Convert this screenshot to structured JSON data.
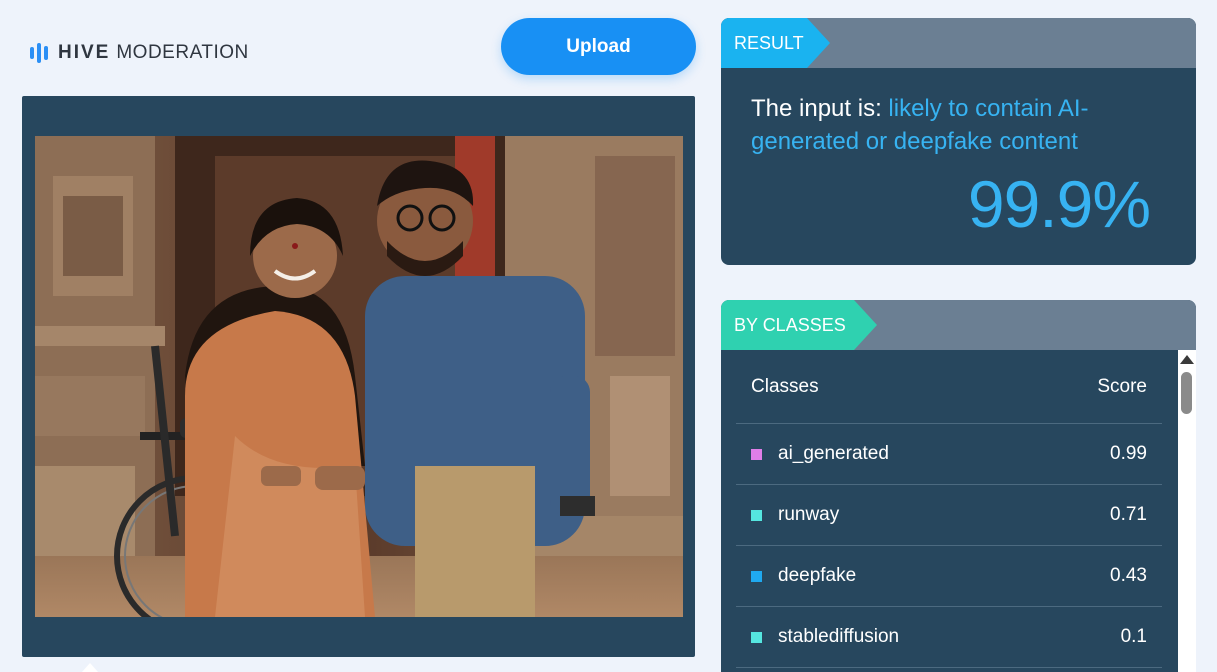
{
  "header": {
    "brand": "HIVE",
    "brand_sub": "MODERATION",
    "upload_label": "Upload"
  },
  "image_panel": {
    "icon": "uploaded-photo",
    "subject": "photo of a smiling woman in a wheelchair and a man in glasses in front of a carved stone temple"
  },
  "result": {
    "tag": "RESULT",
    "prefix": "The input is: ",
    "verdict": "likely to contain AI-generated or deepfake content",
    "percent": "99.9%",
    "accent_color": "#37b3f2"
  },
  "by_classes": {
    "tag": "BY CLASSES",
    "header_class": "Classes",
    "header_score": "Score",
    "rows": [
      {
        "label": "ai_generated",
        "score": "0.99",
        "color": "#e07ee8"
      },
      {
        "label": "runway",
        "score": "0.71",
        "color": "#55e6e0"
      },
      {
        "label": "deepfake",
        "score": "0.43",
        "color": "#1fa9f0"
      },
      {
        "label": "stablediffusion",
        "score": "0.1",
        "color": "#55e6e0"
      }
    ]
  }
}
